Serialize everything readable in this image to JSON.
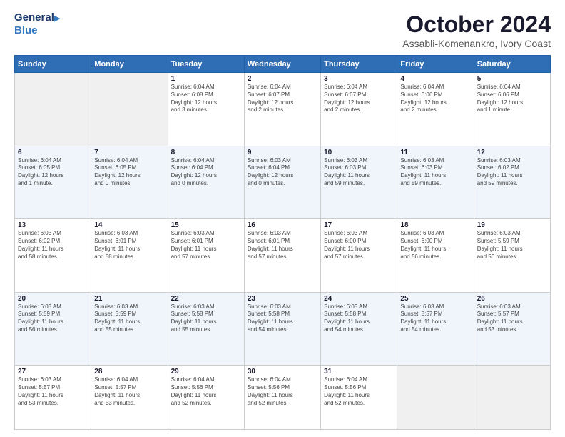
{
  "header": {
    "logo_line1": "General",
    "logo_line2": "Blue",
    "month_year": "October 2024",
    "location": "Assabli-Komenankro, Ivory Coast"
  },
  "weekdays": [
    "Sunday",
    "Monday",
    "Tuesday",
    "Wednesday",
    "Thursday",
    "Friday",
    "Saturday"
  ],
  "weeks": [
    [
      {
        "day": "",
        "info": ""
      },
      {
        "day": "",
        "info": ""
      },
      {
        "day": "1",
        "info": "Sunrise: 6:04 AM\nSunset: 6:08 PM\nDaylight: 12 hours\nand 3 minutes."
      },
      {
        "day": "2",
        "info": "Sunrise: 6:04 AM\nSunset: 6:07 PM\nDaylight: 12 hours\nand 2 minutes."
      },
      {
        "day": "3",
        "info": "Sunrise: 6:04 AM\nSunset: 6:07 PM\nDaylight: 12 hours\nand 2 minutes."
      },
      {
        "day": "4",
        "info": "Sunrise: 6:04 AM\nSunset: 6:06 PM\nDaylight: 12 hours\nand 2 minutes."
      },
      {
        "day": "5",
        "info": "Sunrise: 6:04 AM\nSunset: 6:06 PM\nDaylight: 12 hours\nand 1 minute."
      }
    ],
    [
      {
        "day": "6",
        "info": "Sunrise: 6:04 AM\nSunset: 6:05 PM\nDaylight: 12 hours\nand 1 minute."
      },
      {
        "day": "7",
        "info": "Sunrise: 6:04 AM\nSunset: 6:05 PM\nDaylight: 12 hours\nand 0 minutes."
      },
      {
        "day": "8",
        "info": "Sunrise: 6:04 AM\nSunset: 6:04 PM\nDaylight: 12 hours\nand 0 minutes."
      },
      {
        "day": "9",
        "info": "Sunrise: 6:03 AM\nSunset: 6:04 PM\nDaylight: 12 hours\nand 0 minutes."
      },
      {
        "day": "10",
        "info": "Sunrise: 6:03 AM\nSunset: 6:03 PM\nDaylight: 11 hours\nand 59 minutes."
      },
      {
        "day": "11",
        "info": "Sunrise: 6:03 AM\nSunset: 6:03 PM\nDaylight: 11 hours\nand 59 minutes."
      },
      {
        "day": "12",
        "info": "Sunrise: 6:03 AM\nSunset: 6:02 PM\nDaylight: 11 hours\nand 59 minutes."
      }
    ],
    [
      {
        "day": "13",
        "info": "Sunrise: 6:03 AM\nSunset: 6:02 PM\nDaylight: 11 hours\nand 58 minutes."
      },
      {
        "day": "14",
        "info": "Sunrise: 6:03 AM\nSunset: 6:01 PM\nDaylight: 11 hours\nand 58 minutes."
      },
      {
        "day": "15",
        "info": "Sunrise: 6:03 AM\nSunset: 6:01 PM\nDaylight: 11 hours\nand 57 minutes."
      },
      {
        "day": "16",
        "info": "Sunrise: 6:03 AM\nSunset: 6:01 PM\nDaylight: 11 hours\nand 57 minutes."
      },
      {
        "day": "17",
        "info": "Sunrise: 6:03 AM\nSunset: 6:00 PM\nDaylight: 11 hours\nand 57 minutes."
      },
      {
        "day": "18",
        "info": "Sunrise: 6:03 AM\nSunset: 6:00 PM\nDaylight: 11 hours\nand 56 minutes."
      },
      {
        "day": "19",
        "info": "Sunrise: 6:03 AM\nSunset: 5:59 PM\nDaylight: 11 hours\nand 56 minutes."
      }
    ],
    [
      {
        "day": "20",
        "info": "Sunrise: 6:03 AM\nSunset: 5:59 PM\nDaylight: 11 hours\nand 56 minutes."
      },
      {
        "day": "21",
        "info": "Sunrise: 6:03 AM\nSunset: 5:59 PM\nDaylight: 11 hours\nand 55 minutes."
      },
      {
        "day": "22",
        "info": "Sunrise: 6:03 AM\nSunset: 5:58 PM\nDaylight: 11 hours\nand 55 minutes."
      },
      {
        "day": "23",
        "info": "Sunrise: 6:03 AM\nSunset: 5:58 PM\nDaylight: 11 hours\nand 54 minutes."
      },
      {
        "day": "24",
        "info": "Sunrise: 6:03 AM\nSunset: 5:58 PM\nDaylight: 11 hours\nand 54 minutes."
      },
      {
        "day": "25",
        "info": "Sunrise: 6:03 AM\nSunset: 5:57 PM\nDaylight: 11 hours\nand 54 minutes."
      },
      {
        "day": "26",
        "info": "Sunrise: 6:03 AM\nSunset: 5:57 PM\nDaylight: 11 hours\nand 53 minutes."
      }
    ],
    [
      {
        "day": "27",
        "info": "Sunrise: 6:03 AM\nSunset: 5:57 PM\nDaylight: 11 hours\nand 53 minutes."
      },
      {
        "day": "28",
        "info": "Sunrise: 6:04 AM\nSunset: 5:57 PM\nDaylight: 11 hours\nand 53 minutes."
      },
      {
        "day": "29",
        "info": "Sunrise: 6:04 AM\nSunset: 5:56 PM\nDaylight: 11 hours\nand 52 minutes."
      },
      {
        "day": "30",
        "info": "Sunrise: 6:04 AM\nSunset: 5:56 PM\nDaylight: 11 hours\nand 52 minutes."
      },
      {
        "day": "31",
        "info": "Sunrise: 6:04 AM\nSunset: 5:56 PM\nDaylight: 11 hours\nand 52 minutes."
      },
      {
        "day": "",
        "info": ""
      },
      {
        "day": "",
        "info": ""
      }
    ]
  ]
}
